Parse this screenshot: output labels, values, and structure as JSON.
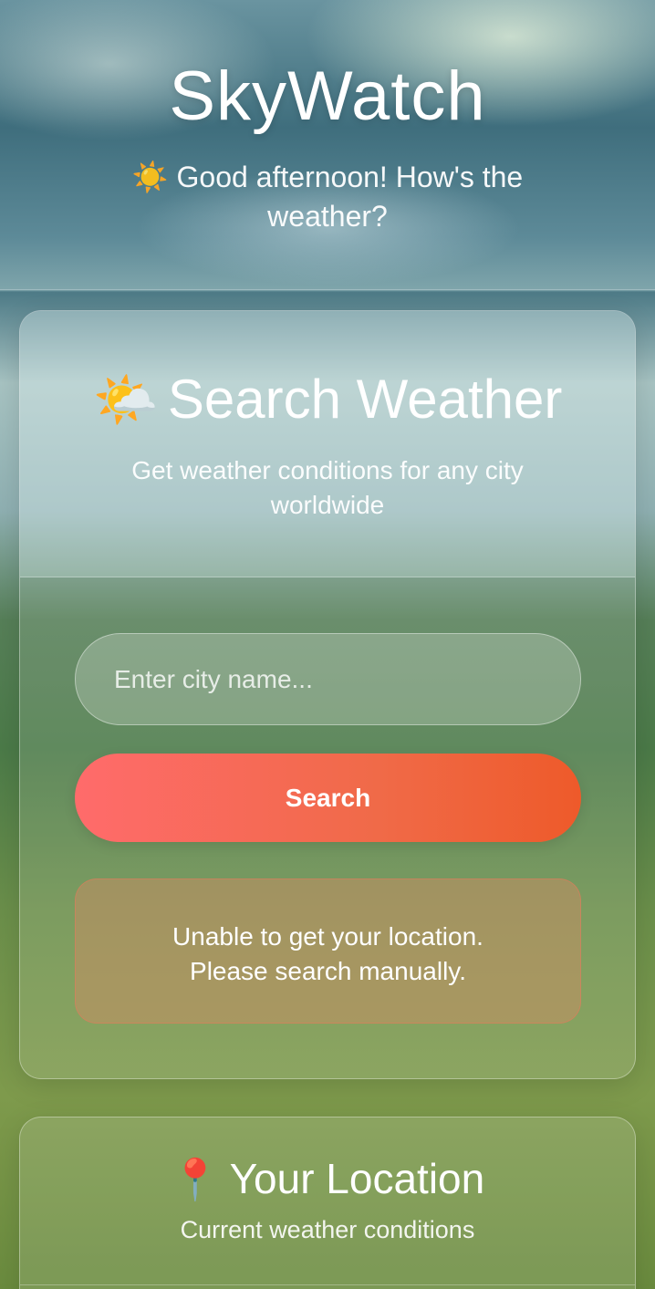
{
  "header": {
    "app_title": "SkyWatch",
    "greeting_icon": "☀️",
    "greeting_text": "Good afternoon! How's the weather?"
  },
  "search_card": {
    "title_icon": "🌤️",
    "title": "Search Weather",
    "subtitle": "Get weather conditions for any city worldwide",
    "input_placeholder": "Enter city name...",
    "input_value": "",
    "search_button_label": "Search",
    "error_line1": "Unable to get your location.",
    "error_line2": "Please search manually."
  },
  "location_card": {
    "title_icon": "📍",
    "title": "Your Location",
    "subtitle": "Current weather conditions"
  },
  "colors": {
    "button_start": "#ff6b6b",
    "button_end": "#ee5a2a",
    "error_bg": "#d28c64"
  }
}
